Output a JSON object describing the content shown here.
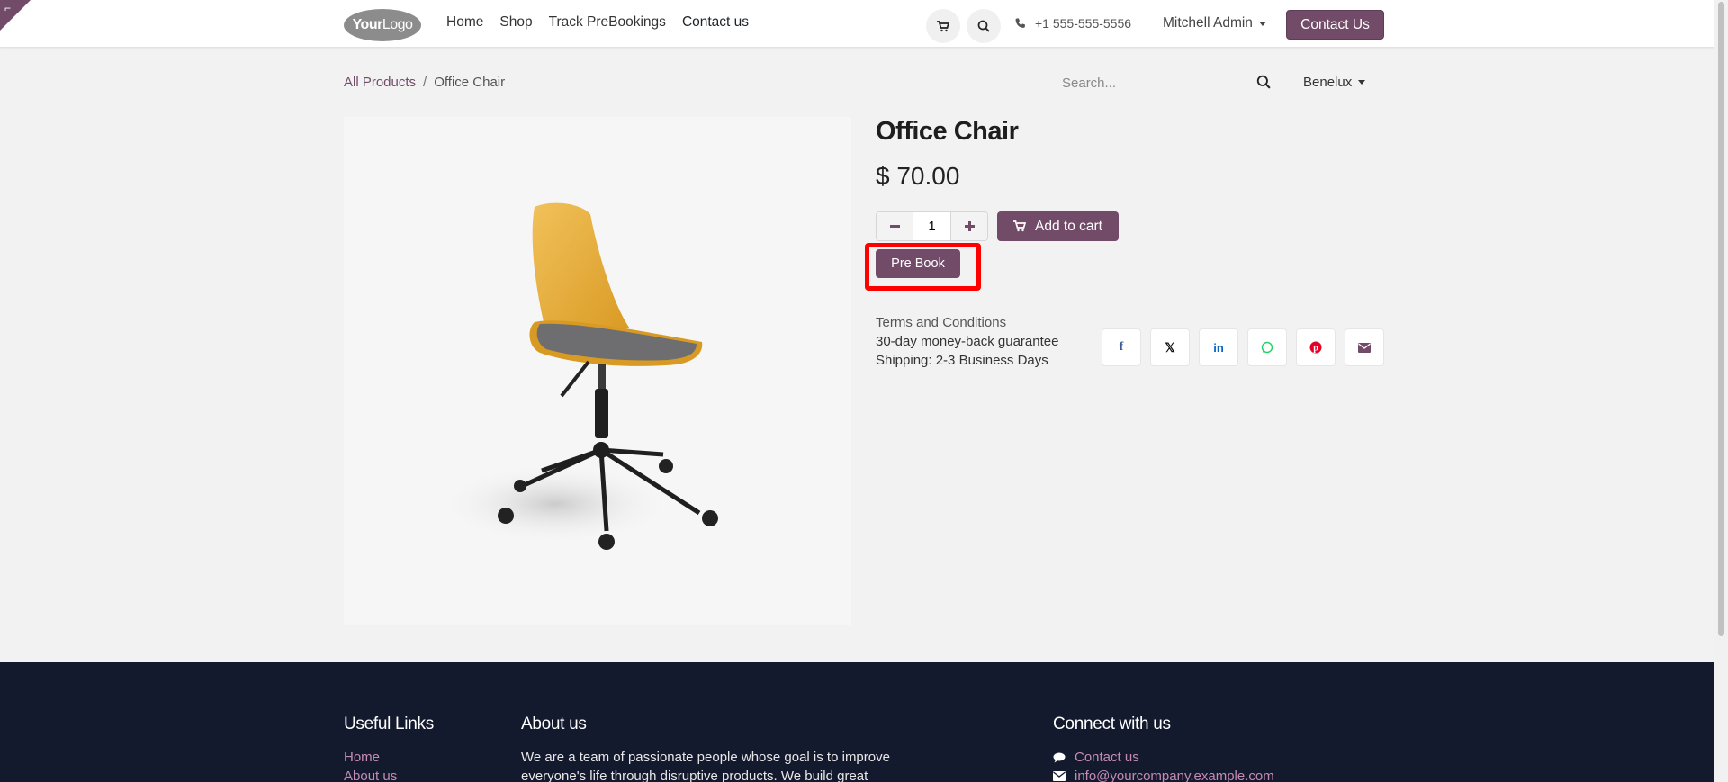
{
  "header": {
    "logo_bold": "Your",
    "logo_light": "Logo",
    "nav": [
      "Home",
      "Shop",
      "Track PreBookings",
      "Contact us"
    ],
    "phone": "+1 555-555-5556",
    "user": "Mitchell Admin",
    "contact_button": "Contact Us"
  },
  "breadcrumb": {
    "parent": "All Products",
    "separator": "/",
    "current": "Office Chair"
  },
  "search": {
    "placeholder": "Search..."
  },
  "pricelist": "Benelux",
  "product": {
    "name": "Office Chair",
    "price": "$ 70.00",
    "quantity": "1",
    "add_to_cart": "Add to cart",
    "prebook": "Pre Book",
    "terms": "Terms and Conditions",
    "guarantee": "30-day money-back guarantee",
    "shipping": "Shipping: 2-3 Business Days"
  },
  "share_icons": [
    "facebook-icon",
    "x-icon",
    "linkedin-icon",
    "whatsapp-icon",
    "pinterest-icon",
    "email-icon"
  ],
  "footer": {
    "useful_links_title": "Useful Links",
    "useful_links": [
      "Home",
      "About us"
    ],
    "about_title": "About us",
    "about_text": "We are a team of passionate people whose goal is to improve everyone's life through disruptive products. We build great",
    "connect_title": "Connect with us",
    "contact_link": "Contact us",
    "email": "info@yourcompany.example.com"
  },
  "colors": {
    "brand": "#714b67",
    "highlight": "#ff0000",
    "footer_bg": "#141a2e",
    "footer_link": "#c48bb5"
  }
}
